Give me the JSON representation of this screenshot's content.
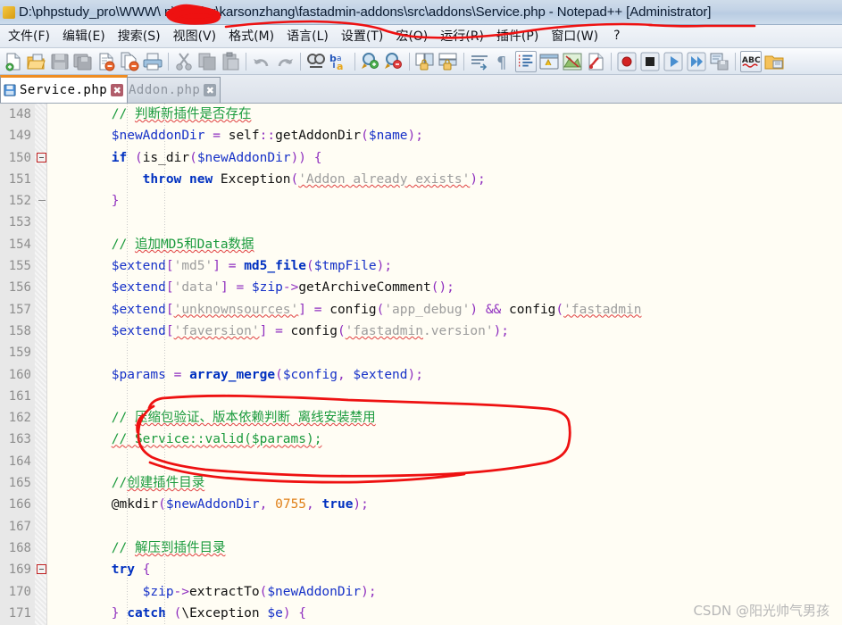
{
  "window": {
    "title": "D:\\phpstudy_pro\\WWW\\      n\\vendor\\karsonzhang\\fastadmin-addons\\src\\addons\\Service.php - Notepad++ [Administrator]",
    "title_prefix": "D:\\phpstudy_pro\\WWW\\",
    "title_suffix": "n\\vendor\\karsonzhang\\fastadmin-addons\\src\\addons\\Service.php - Notepad++ [Administrator]",
    "app_icon": "notepad-plus-plus-icon"
  },
  "menu": {
    "items": [
      {
        "label": "文件(F)",
        "name": "menu-file"
      },
      {
        "label": "编辑(E)",
        "name": "menu-edit"
      },
      {
        "label": "搜索(S)",
        "name": "menu-search"
      },
      {
        "label": "视图(V)",
        "name": "menu-view"
      },
      {
        "label": "格式(M)",
        "name": "menu-format"
      },
      {
        "label": "语言(L)",
        "name": "menu-language"
      },
      {
        "label": "设置(T)",
        "name": "menu-settings"
      },
      {
        "label": "宏(O)",
        "name": "menu-macro"
      },
      {
        "label": "运行(R)",
        "name": "menu-run"
      },
      {
        "label": "插件(P)",
        "name": "menu-plugins"
      },
      {
        "label": "窗口(W)",
        "name": "menu-window"
      },
      {
        "label": "?",
        "name": "menu-help"
      }
    ]
  },
  "toolbar": {
    "buttons": [
      {
        "icon": "new-file-icon"
      },
      {
        "icon": "open-file-icon"
      },
      {
        "icon": "save-icon"
      },
      {
        "icon": "save-all-icon"
      },
      {
        "icon": "close-file-icon"
      },
      {
        "icon": "close-all-icon"
      },
      {
        "icon": "print-icon"
      },
      {
        "icon": "cut-icon"
      },
      {
        "icon": "copy-icon"
      },
      {
        "icon": "paste-icon"
      },
      {
        "icon": "undo-icon"
      },
      {
        "icon": "redo-icon"
      },
      {
        "icon": "find-icon"
      },
      {
        "icon": "replace-icon"
      },
      {
        "icon": "zoom-in-icon"
      },
      {
        "icon": "zoom-out-icon"
      },
      {
        "icon": "sync-vertical-scroll-icon"
      },
      {
        "icon": "sync-horizontal-scroll-icon"
      },
      {
        "icon": "word-wrap-icon"
      },
      {
        "icon": "show-all-chars-icon"
      },
      {
        "icon": "indent-guide-icon"
      },
      {
        "icon": "user-defined-language-icon"
      },
      {
        "icon": "document-map-icon"
      },
      {
        "icon": "function-list-icon"
      },
      {
        "icon": "record-macro-icon"
      },
      {
        "icon": "stop-macro-icon"
      },
      {
        "icon": "play-macro-icon"
      },
      {
        "icon": "play-macro-multiple-icon"
      },
      {
        "icon": "save-macro-icon"
      },
      {
        "icon": "spell-check-icon"
      },
      {
        "icon": "folder-as-workspace-icon"
      }
    ]
  },
  "tabs": [
    {
      "label": "Service.php",
      "active": true,
      "close": "✖",
      "icon": "saved-file-icon",
      "name": "tab-service-php"
    },
    {
      "label": "Addon.php",
      "active": false,
      "close": "✖",
      "icon": "saved-file-icon",
      "name": "tab-addon-php"
    }
  ],
  "editor": {
    "first_line": 148,
    "fold_lines": [
      150,
      169
    ],
    "fold_tick_lines": [
      152
    ],
    "lines": [
      {
        "n": 148,
        "indent": 8,
        "tokens": [
          {
            "t": "com",
            "v": "// "
          },
          {
            "t": "comcn",
            "v": "判断新插件是否存在",
            "sq": true
          }
        ]
      },
      {
        "n": 149,
        "indent": 8,
        "tokens": [
          {
            "t": "var",
            "v": "$newAddonDir"
          },
          {
            "t": "plain",
            "v": " "
          },
          {
            "t": "op",
            "v": "="
          },
          {
            "t": "plain",
            "v": " self"
          },
          {
            "t": "op",
            "v": "::"
          },
          {
            "t": "plain",
            "v": "getAddonDir"
          },
          {
            "t": "punc",
            "v": "("
          },
          {
            "t": "var",
            "v": "$name"
          },
          {
            "t": "punc",
            "v": ");"
          }
        ]
      },
      {
        "n": 150,
        "indent": 8,
        "tokens": [
          {
            "t": "kw",
            "v": "if"
          },
          {
            "t": "plain",
            "v": " "
          },
          {
            "t": "punc",
            "v": "("
          },
          {
            "t": "plain",
            "v": "is_dir"
          },
          {
            "t": "punc",
            "v": "("
          },
          {
            "t": "var",
            "v": "$newAddonDir"
          },
          {
            "t": "punc",
            "v": "))"
          },
          {
            "t": "plain",
            "v": " "
          },
          {
            "t": "punc",
            "v": "{"
          }
        ]
      },
      {
        "n": 151,
        "indent": 12,
        "tokens": [
          {
            "t": "kw",
            "v": "throw new"
          },
          {
            "t": "plain",
            "v": " Exception"
          },
          {
            "t": "punc",
            "v": "("
          },
          {
            "t": "str",
            "v": "'Addon already exists'",
            "sq": true
          },
          {
            "t": "punc",
            "v": ");"
          }
        ]
      },
      {
        "n": 152,
        "indent": 8,
        "tokens": [
          {
            "t": "punc",
            "v": "}"
          }
        ]
      },
      {
        "n": 153,
        "indent": 0,
        "tokens": []
      },
      {
        "n": 154,
        "indent": 8,
        "tokens": [
          {
            "t": "com",
            "v": "// "
          },
          {
            "t": "comcn",
            "v": "追加MD5和Data数据",
            "sq": true
          }
        ]
      },
      {
        "n": 155,
        "indent": 8,
        "tokens": [
          {
            "t": "var",
            "v": "$extend"
          },
          {
            "t": "punc",
            "v": "["
          },
          {
            "t": "str",
            "v": "'md5'"
          },
          {
            "t": "punc",
            "v": "]"
          },
          {
            "t": "plain",
            "v": " "
          },
          {
            "t": "op",
            "v": "="
          },
          {
            "t": "plain",
            "v": " "
          },
          {
            "t": "fn",
            "v": "md5_file"
          },
          {
            "t": "punc",
            "v": "("
          },
          {
            "t": "var",
            "v": "$tmpFile"
          },
          {
            "t": "punc",
            "v": ");"
          }
        ]
      },
      {
        "n": 156,
        "indent": 8,
        "tokens": [
          {
            "t": "var",
            "v": "$extend"
          },
          {
            "t": "punc",
            "v": "["
          },
          {
            "t": "str",
            "v": "'data'"
          },
          {
            "t": "punc",
            "v": "]"
          },
          {
            "t": "plain",
            "v": " "
          },
          {
            "t": "op",
            "v": "="
          },
          {
            "t": "plain",
            "v": " "
          },
          {
            "t": "var",
            "v": "$zip"
          },
          {
            "t": "op",
            "v": "->"
          },
          {
            "t": "plain",
            "v": "getArchiveComment"
          },
          {
            "t": "punc",
            "v": "();"
          }
        ]
      },
      {
        "n": 157,
        "indent": 8,
        "tokens": [
          {
            "t": "var",
            "v": "$extend"
          },
          {
            "t": "punc",
            "v": "["
          },
          {
            "t": "str",
            "v": "'unknownsources'",
            "sq": true
          },
          {
            "t": "punc",
            "v": "]"
          },
          {
            "t": "plain",
            "v": " "
          },
          {
            "t": "op",
            "v": "="
          },
          {
            "t": "plain",
            "v": " config"
          },
          {
            "t": "punc",
            "v": "("
          },
          {
            "t": "str",
            "v": "'app_debug'"
          },
          {
            "t": "punc",
            "v": ")"
          },
          {
            "t": "plain",
            "v": " "
          },
          {
            "t": "op",
            "v": "&&"
          },
          {
            "t": "plain",
            "v": " config"
          },
          {
            "t": "punc",
            "v": "("
          },
          {
            "t": "str",
            "v": "'fastadmin",
            "sq": true
          }
        ]
      },
      {
        "n": 158,
        "indent": 8,
        "tokens": [
          {
            "t": "var",
            "v": "$extend"
          },
          {
            "t": "punc",
            "v": "["
          },
          {
            "t": "str",
            "v": "'faversion'",
            "sq": true
          },
          {
            "t": "punc",
            "v": "]"
          },
          {
            "t": "plain",
            "v": " "
          },
          {
            "t": "op",
            "v": "="
          },
          {
            "t": "plain",
            "v": " config"
          },
          {
            "t": "punc",
            "v": "("
          },
          {
            "t": "str",
            "v": "'fastadmin",
            "sq": true
          },
          {
            "t": "str",
            "v": ".version'"
          },
          {
            "t": "punc",
            "v": ");"
          }
        ]
      },
      {
        "n": 159,
        "indent": 0,
        "tokens": []
      },
      {
        "n": 160,
        "indent": 8,
        "tokens": [
          {
            "t": "var",
            "v": "$params"
          },
          {
            "t": "plain",
            "v": " "
          },
          {
            "t": "op",
            "v": "="
          },
          {
            "t": "plain",
            "v": " "
          },
          {
            "t": "fn",
            "v": "array_merge"
          },
          {
            "t": "punc",
            "v": "("
          },
          {
            "t": "var",
            "v": "$config"
          },
          {
            "t": "punc",
            "v": ","
          },
          {
            "t": "plain",
            "v": " "
          },
          {
            "t": "var",
            "v": "$extend"
          },
          {
            "t": "punc",
            "v": ");"
          }
        ]
      },
      {
        "n": 161,
        "indent": 0,
        "tokens": []
      },
      {
        "n": 162,
        "indent": 8,
        "tokens": [
          {
            "t": "com",
            "v": "// "
          },
          {
            "t": "comcn",
            "v": "压缩包验证、版本依赖判断 离线安装禁用",
            "sq": true
          }
        ]
      },
      {
        "n": 163,
        "indent": 8,
        "tokens": [
          {
            "t": "com",
            "v": "// Service::valid($params);",
            "sq": true
          }
        ]
      },
      {
        "n": 164,
        "indent": 0,
        "tokens": []
      },
      {
        "n": 165,
        "indent": 8,
        "tokens": [
          {
            "t": "com",
            "v": "//"
          },
          {
            "t": "comcn",
            "v": "创建插件目录",
            "sq": true
          }
        ]
      },
      {
        "n": 166,
        "indent": 8,
        "tokens": [
          {
            "t": "plain",
            "v": "@mkdir"
          },
          {
            "t": "punc",
            "v": "("
          },
          {
            "t": "var",
            "v": "$newAddonDir"
          },
          {
            "t": "punc",
            "v": ","
          },
          {
            "t": "plain",
            "v": " "
          },
          {
            "t": "num",
            "v": "0755"
          },
          {
            "t": "punc",
            "v": ","
          },
          {
            "t": "plain",
            "v": " "
          },
          {
            "t": "kw",
            "v": "true"
          },
          {
            "t": "punc",
            "v": ");"
          }
        ]
      },
      {
        "n": 167,
        "indent": 0,
        "tokens": []
      },
      {
        "n": 168,
        "indent": 8,
        "tokens": [
          {
            "t": "com",
            "v": "// "
          },
          {
            "t": "comcn",
            "v": "解压到插件目录",
            "sq": true
          }
        ]
      },
      {
        "n": 169,
        "indent": 8,
        "tokens": [
          {
            "t": "kw",
            "v": "try"
          },
          {
            "t": "plain",
            "v": " "
          },
          {
            "t": "punc",
            "v": "{"
          }
        ]
      },
      {
        "n": 170,
        "indent": 12,
        "tokens": [
          {
            "t": "var",
            "v": "$zip"
          },
          {
            "t": "op",
            "v": "->"
          },
          {
            "t": "plain",
            "v": "extractTo"
          },
          {
            "t": "punc",
            "v": "("
          },
          {
            "t": "var",
            "v": "$newAddonDir"
          },
          {
            "t": "punc",
            "v": ");"
          }
        ]
      },
      {
        "n": 171,
        "indent": 8,
        "tokens": [
          {
            "t": "punc",
            "v": "} "
          },
          {
            "t": "kw",
            "v": "catch"
          },
          {
            "t": "plain",
            "v": " "
          },
          {
            "t": "punc",
            "v": "("
          },
          {
            "t": "plain",
            "v": "\\Exception "
          },
          {
            "t": "var",
            "v": "$e"
          },
          {
            "t": "punc",
            "v": ") {"
          }
        ]
      }
    ]
  },
  "annotations": [
    {
      "name": "redaction-scribble-title",
      "type": "scribble",
      "color": "#ee1111"
    },
    {
      "name": "menu-underline-stroke",
      "type": "stroke",
      "color": "#ee1111"
    },
    {
      "name": "circled-code-highlight",
      "type": "ellipse",
      "color": "#ee1111"
    }
  ],
  "watermark": {
    "text": "CSDN @阳光帅气男孩"
  },
  "colors": {
    "accent_tab": "#ef8d22",
    "annotation": "#ee1111",
    "comment": "#1a9a3c",
    "keyword": "#0030c0",
    "variable": "#1631c8",
    "operator": "#8f2fbf",
    "string": "#9d9d9d",
    "number": "#e08018",
    "editor_bg": "#fffdf4",
    "gutter_bg": "#e8e8e8"
  }
}
